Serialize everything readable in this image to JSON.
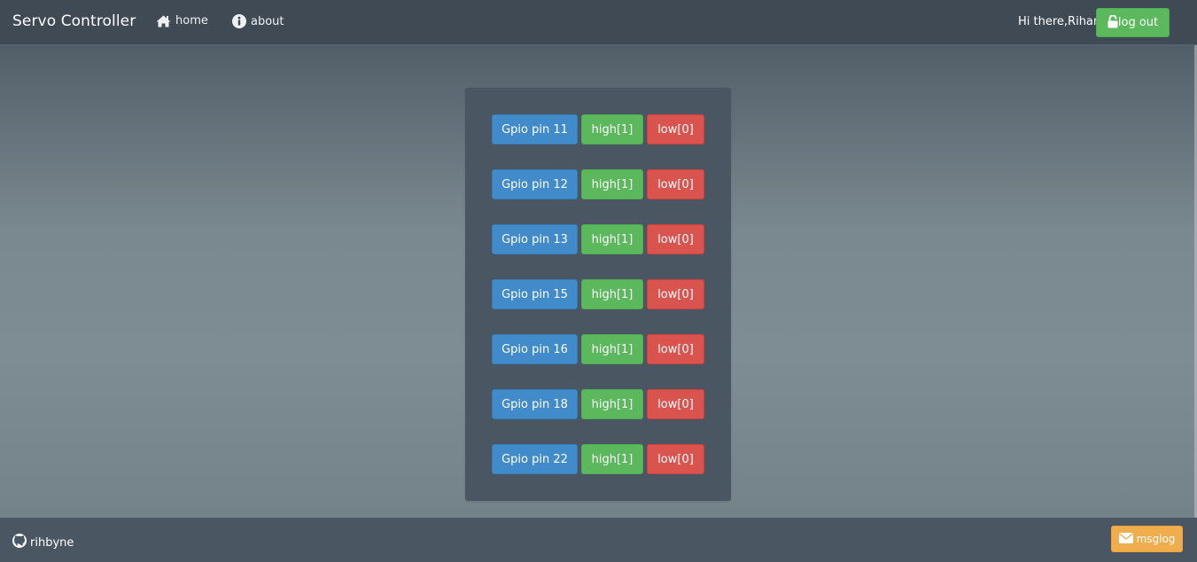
{
  "navbar": {
    "brand": "Servo Controller",
    "home_label": "home",
    "about_label": "about",
    "greeting": "Hi there,Rihan",
    "logout_label": "log out"
  },
  "pins": [
    {
      "label": "Gpio pin 11",
      "high": "high[1]",
      "low": "low[0]"
    },
    {
      "label": "Gpio pin 12",
      "high": "high[1]",
      "low": "low[0]"
    },
    {
      "label": "Gpio pin 13",
      "high": "high[1]",
      "low": "low[0]"
    },
    {
      "label": "Gpio pin 15",
      "high": "high[1]",
      "low": "low[0]"
    },
    {
      "label": "Gpio pin 16",
      "high": "high[1]",
      "low": "low[0]"
    },
    {
      "label": "Gpio pin 18",
      "high": "high[1]",
      "low": "low[0]"
    },
    {
      "label": "Gpio pin 22",
      "high": "high[1]",
      "low": "low[0]"
    }
  ],
  "footer": {
    "github_user": "rihbyne",
    "msglog_label": "msglog"
  },
  "icons": {
    "home": "home-icon",
    "about": "info-icon",
    "lock": "unlock-icon",
    "github": "github-icon",
    "envelope": "envelope-icon"
  },
  "colors": {
    "primary": "#428bca",
    "success": "#5cb85c",
    "danger": "#d9534f",
    "warning": "#f0ad4e",
    "navbar": "#3f4a55",
    "panel": "#4a5661"
  }
}
